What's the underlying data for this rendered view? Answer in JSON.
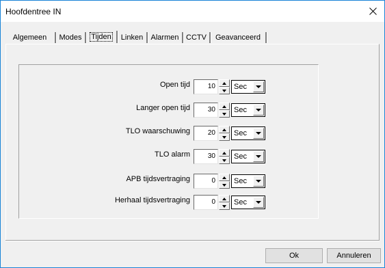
{
  "window": {
    "title": "Hoofdentree IN"
  },
  "tabs": [
    {
      "label": "Algemeen"
    },
    {
      "label": "Modes"
    },
    {
      "label": "Tijden"
    },
    {
      "label": "Linken"
    },
    {
      "label": "Alarmen"
    },
    {
      "label": "CCTV"
    },
    {
      "label": "Geavanceerd"
    }
  ],
  "active_tab": "Tijden",
  "rows": [
    {
      "label": "Open tijd",
      "value": "10",
      "unit": "Sec"
    },
    {
      "label": "Langer open tijd",
      "value": "30",
      "unit": "Sec"
    },
    {
      "label": "TLO waarschuwing",
      "value": "20",
      "unit": "Sec"
    },
    {
      "label": "TLO alarm",
      "value": "30",
      "unit": "Sec"
    },
    {
      "label": "APB tijdsvertraging",
      "value": "0",
      "unit": "Sec"
    },
    {
      "label": "Herhaal tijdsvertraging",
      "value": "0",
      "unit": "Sec"
    }
  ],
  "buttons": {
    "ok": "Ok",
    "cancel": "Annuleren"
  },
  "icons": {
    "close": "close-icon",
    "spin_up": "arrow-up-icon",
    "spin_down": "arrow-down-icon",
    "dropdown": "chevron-down-icon"
  }
}
